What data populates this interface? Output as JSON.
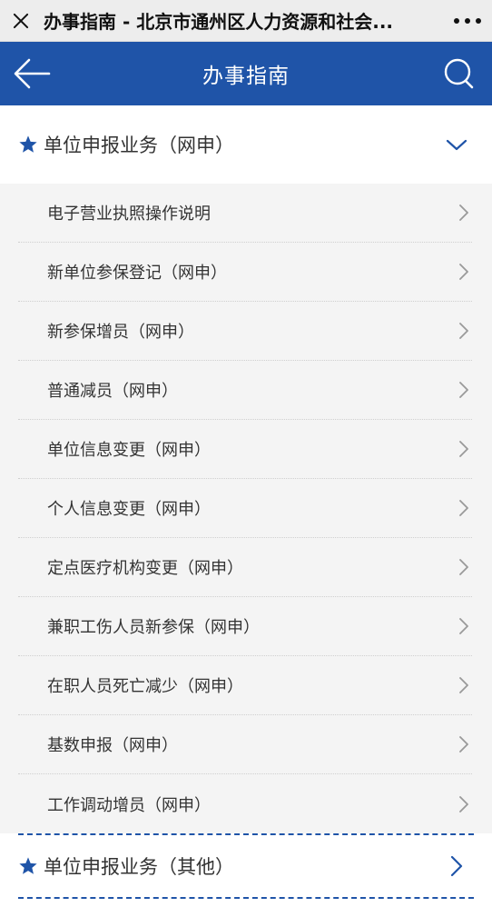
{
  "topbar": {
    "title": "办事指南 - 北京市通州区人力资源和社会..."
  },
  "header": {
    "title": "办事指南"
  },
  "sections": [
    {
      "title": "单位申报业务（网申）",
      "items": [
        "电子营业执照操作说明",
        "新单位参保登记（网申）",
        "新参保增员（网申）",
        "普通减员（网申）",
        "单位信息变更（网申）",
        "个人信息变更（网申）",
        "定点医疗机构变更（网申）",
        "兼职工伤人员新参保（网申）",
        "在职人员死亡减少（网申）",
        "基数申报（网申）",
        "工作调动增员（网申）"
      ]
    },
    {
      "title": "单位申报业务（其他）"
    }
  ],
  "colors": {
    "brand_blue": "#1f54a8",
    "list_bg": "#f4f4f4"
  },
  "icons": [
    "close-icon",
    "more-icon",
    "back-arrow-icon",
    "search-icon",
    "star-icon",
    "chevron-down-icon",
    "chevron-right-icon"
  ]
}
